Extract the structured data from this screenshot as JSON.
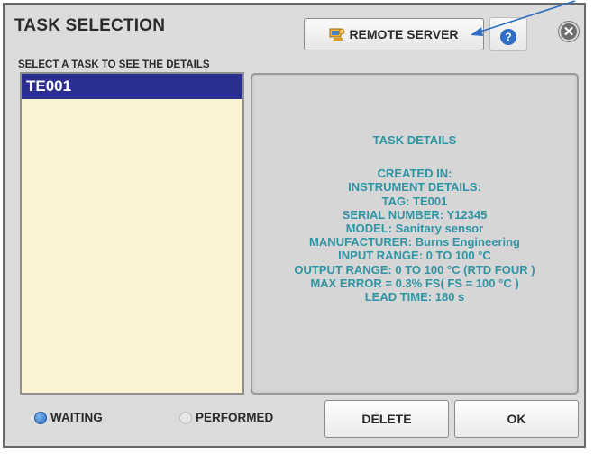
{
  "header": {
    "title": "TASK SELECTION",
    "remote_server_label": "REMOTE SERVER",
    "help_glyph": "?",
    "close_glyph": "✕"
  },
  "list": {
    "subtitle": "SELECT A TASK TO SEE THE DETAILS",
    "items": [
      "TE001"
    ],
    "selected": "TE001"
  },
  "details": {
    "heading": "TASK DETAILS",
    "lines": [
      "CREATED IN:",
      "INSTRUMENT DETAILS:",
      "TAG: TE001",
      "SERIAL NUMBER: Y12345",
      "MODEL: Sanitary sensor",
      "MANUFACTURER: Burns Engineering",
      "INPUT RANGE: 0 TO 100 °C",
      "OUTPUT RANGE: 0 TO 100 °C (RTD FOUR )",
      "MAX ERROR = 0.3% FS( FS = 100 °C )",
      "LEAD TIME: 180 s"
    ]
  },
  "footer": {
    "status_waiting": "WAITING",
    "status_performed": "PERFORMED",
    "delete_label": "DELETE",
    "ok_label": "OK"
  },
  "icons": {
    "remote_server": "server-icon",
    "help": "help-icon",
    "close": "close-icon",
    "annotation": "arrow-icon"
  },
  "colors": {
    "accent": "#2b2f8f",
    "details_text": "#2f95a5",
    "list_background": "#fcf3d3",
    "status_active": "#2b6dc3"
  }
}
